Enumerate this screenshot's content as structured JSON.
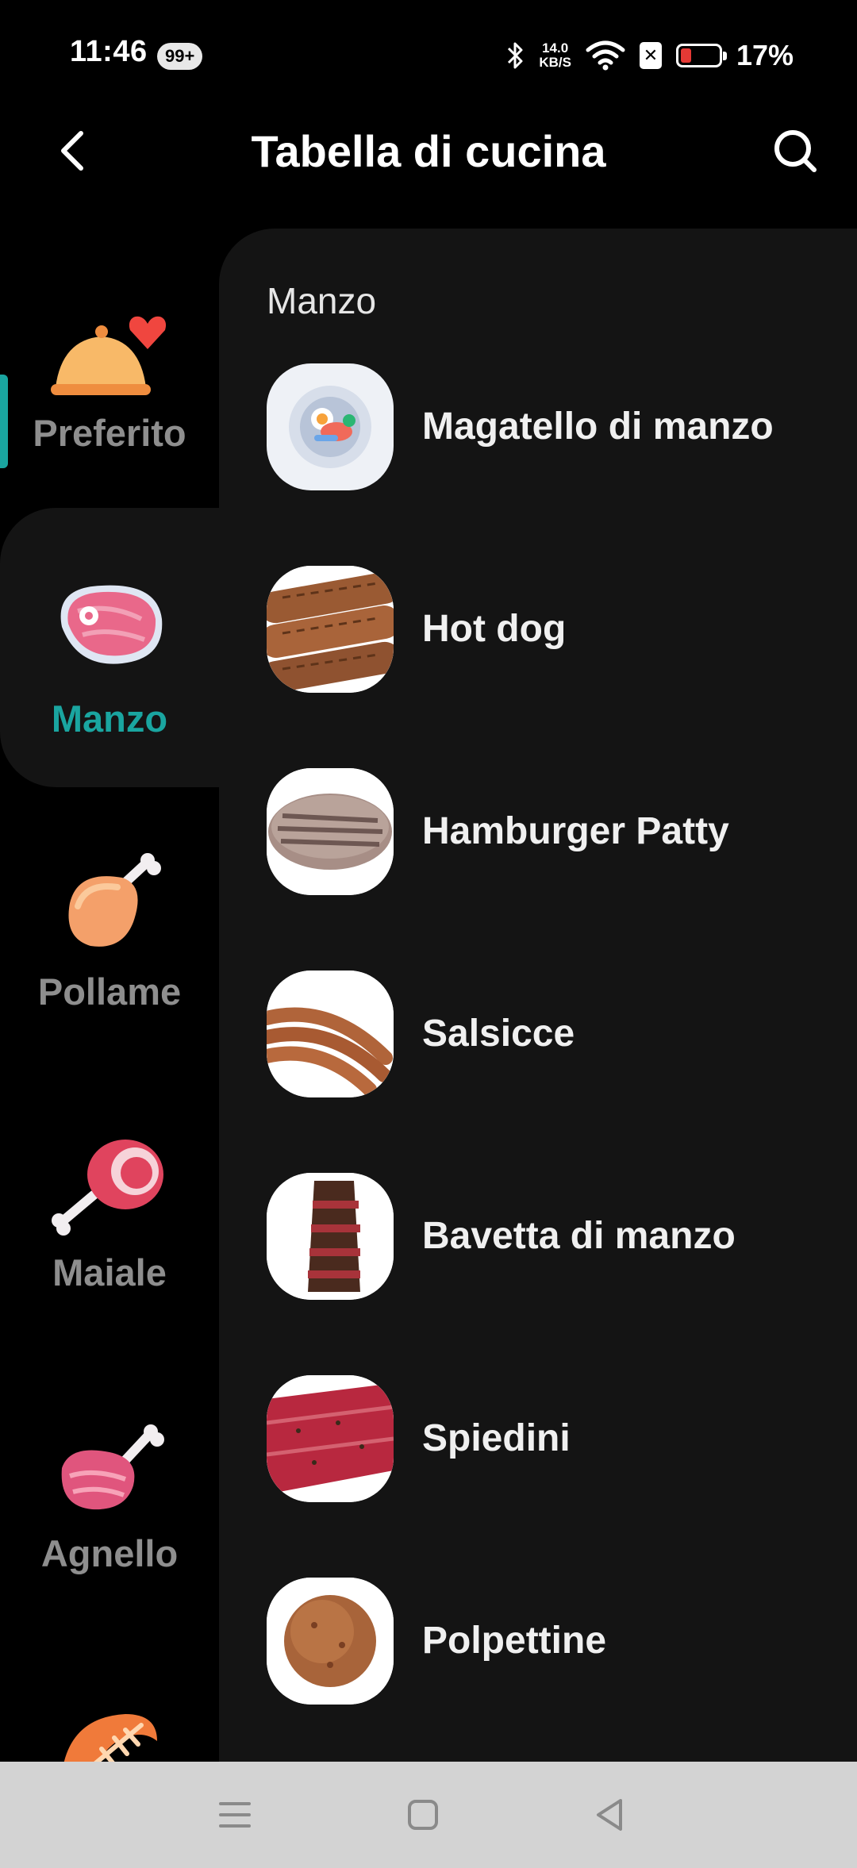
{
  "status_bar": {
    "time": "11:46",
    "notification_badge": "99+",
    "net_speed_value": "14.0",
    "net_speed_unit": "KB/S",
    "battery_percent": "17%",
    "icons": [
      "bluetooth-icon",
      "wifi-icon",
      "no-sim-icon",
      "battery-icon"
    ]
  },
  "header": {
    "title": "Tabella di cucina",
    "back_icon": "chevron-left-icon",
    "search_icon": "search-icon"
  },
  "sidebar": {
    "items": [
      {
        "label": "Preferito",
        "icon": "favorite-dish-icon",
        "active": false
      },
      {
        "label": "Manzo",
        "icon": "beef-steak-icon",
        "active": true
      },
      {
        "label": "Pollame",
        "icon": "chicken-leg-icon",
        "active": false
      },
      {
        "label": "Maiale",
        "icon": "pork-ham-icon",
        "active": false
      },
      {
        "label": "Agnello",
        "icon": "lamb-leg-icon",
        "active": false
      },
      {
        "label": "",
        "icon": "fish-icon",
        "active": false
      }
    ],
    "accent_color": "#1aa5a0"
  },
  "content": {
    "section_title": "Manzo",
    "items": [
      {
        "name": "Magatello di manzo",
        "thumb": "plated-dish-icon"
      },
      {
        "name": "Hot dog",
        "thumb": "grilled-sausages-photo"
      },
      {
        "name": "Hamburger Patty",
        "thumb": "burger-patty-photo"
      },
      {
        "name": "Salsicce",
        "thumb": "sausages-photo"
      },
      {
        "name": "Bavetta di manzo",
        "thumb": "sliced-steak-photo"
      },
      {
        "name": "Spiedini",
        "thumb": "raw-beef-photo"
      },
      {
        "name": "Polpettine",
        "thumb": "meatball-photo"
      }
    ]
  },
  "navbar": {
    "icons": [
      "menu-icon",
      "home-icon",
      "back-icon"
    ]
  }
}
